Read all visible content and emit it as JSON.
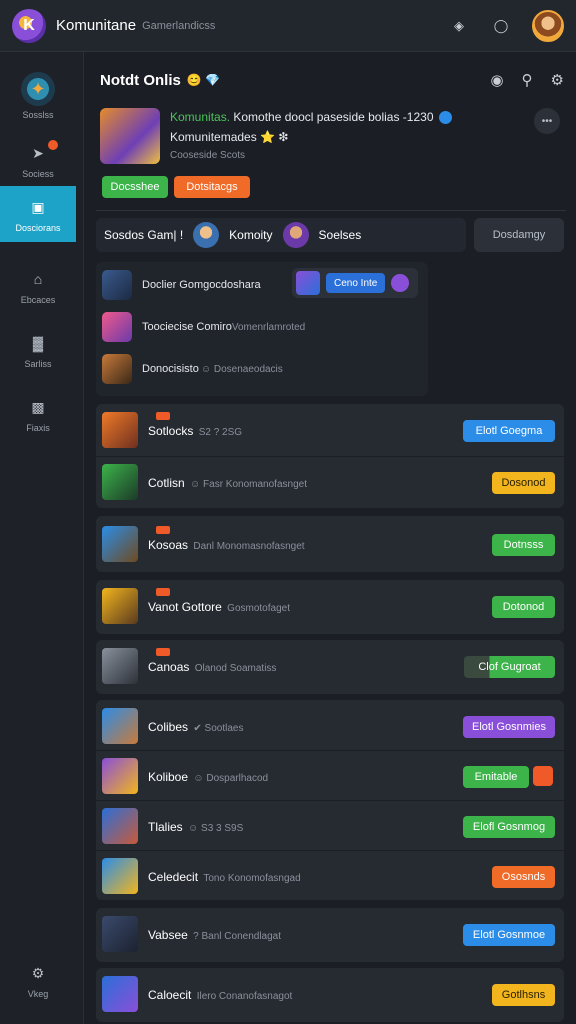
{
  "app": {
    "title": "Komunitane",
    "subtitle": "Gamerlandicss"
  },
  "topbar": {
    "icons": [
      "notification-icon",
      "shield-icon"
    ],
    "user": "avatar"
  },
  "sidebar": {
    "items": [
      {
        "label": "Sosslss",
        "icon": "logo-icon"
      },
      {
        "label": "Sociess",
        "icon": "controller-icon"
      },
      {
        "label": "Dosciorans",
        "icon": "folder-icon",
        "active": true
      },
      {
        "label": "Ebcaces",
        "icon": "house-icon"
      },
      {
        "label": "Sarliss",
        "icon": "chart-icon"
      },
      {
        "label": "Fiaxis",
        "icon": "box-icon"
      }
    ],
    "bottom_label": "Vkeg"
  },
  "main": {
    "section_title": "Notdt Onlis",
    "section_emojis": "😊 💎",
    "feature": {
      "line1_prefix": "Komunitas.",
      "line1_text": " Komothe doocl paseside bolias -1230",
      "line2": "Komunitemades ⭐ ❇",
      "line3": "Cooseside Scots",
      "btn_primary": "Docsshee",
      "btn_secondary": "Dotsitacgs"
    },
    "filter": {
      "label1": "Sosdos Gam| !",
      "label2": "Komoity",
      "label3": "Soelses",
      "button": "Dosdamgy"
    },
    "friends": [
      {
        "name": "Doclier Gomgocdoshara"
      },
      {
        "name": "Toociecise Comiro",
        "sub": "Vomenrlamroted"
      },
      {
        "name": "Donocisisto",
        "sub": "☺ Dosenaeodacis"
      }
    ],
    "friend_tag": "Ceno Inte",
    "games": [
      {
        "name": "Sotlocks",
        "sub": "S2 ? 2SG",
        "button": "Elotl Goegma",
        "color": "blue"
      },
      {
        "name": "Cotlisn",
        "sub": "☺ Fasr Konomanofasnget",
        "button": "Dosonod",
        "color": "yellow"
      },
      {
        "name": "Kosoas",
        "sub": "Danl Monomasnofasnget",
        "button": "Dotnsss",
        "color": "green"
      },
      {
        "name": "Vanot Gottore",
        "sub": "Gosmotofaget",
        "button": "Dotonod",
        "color": "green"
      },
      {
        "name": "Canoas",
        "sub": "Olanod Soamatiss",
        "button": "Clof Gugroat",
        "color": "green"
      },
      {
        "name": "Colibes",
        "sub": "✔ Sootlaes",
        "button": "Elotl Gosnmies",
        "color": "purple"
      },
      {
        "name": "Koliboe",
        "sub": "☺ Dosparlhacod",
        "button": "Emitable",
        "color": "green"
      },
      {
        "name": "Tlalies",
        "sub": "☺ S3 3 S9S",
        "button": "Elofl Gosnmog",
        "color": "green"
      },
      {
        "name": "Celedecit",
        "sub": "Tono Konomofasngad",
        "button": "Ososnds",
        "color": "orange"
      },
      {
        "name": "Vabsee",
        "sub": "? Banl Conendlagat",
        "button": "Elotl Gosnmoe",
        "color": "blue"
      },
      {
        "name": "Caloecit",
        "sub": "Ilero Conanofasnagot",
        "button": "Gotlhsns",
        "color": "yellow"
      }
    ]
  }
}
